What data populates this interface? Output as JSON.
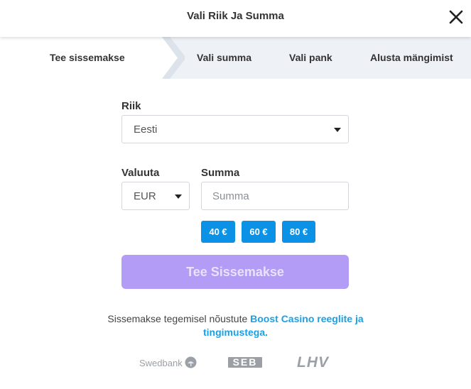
{
  "header": {
    "title": "Vali Riik Ja Summa"
  },
  "steps": [
    "Tee sissemakse",
    "Vali summa",
    "Vali pank",
    "Alusta mängimist"
  ],
  "form": {
    "country_label": "Riik",
    "country_value": "Eesti",
    "currency_label": "Valuuta",
    "currency_value": "EUR",
    "amount_label": "Summa",
    "amount_placeholder": "Summa",
    "quick_amounts": [
      "40 €",
      "60 €",
      "80 €"
    ],
    "submit_label": "Tee Sissemakse"
  },
  "terms": {
    "prefix": "Sissemakse tegemisel nõustute ",
    "link_line1": "Boost Casino reeglite ja",
    "link_line2": "tingimustega."
  },
  "banks": [
    "Swedbank",
    "SEB",
    "LHV"
  ],
  "colors": {
    "accent": "#0b91e6",
    "cta": "#b39cf6",
    "link": "#1aa0e6",
    "steps_bg": "#eef1f5"
  }
}
